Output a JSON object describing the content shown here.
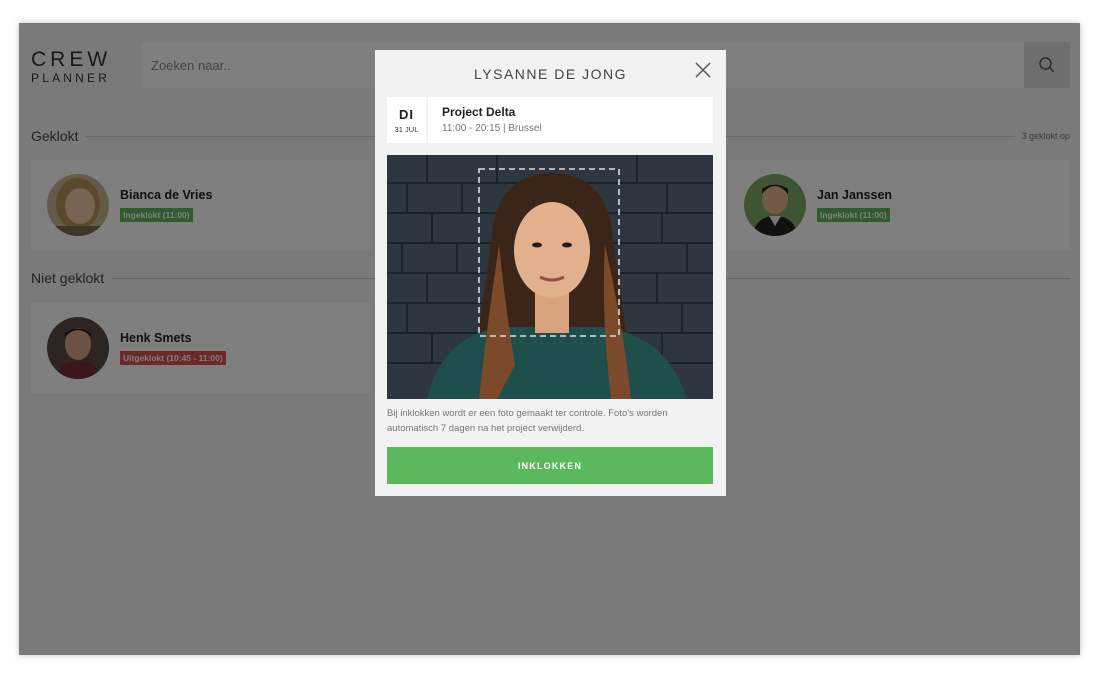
{
  "app": {
    "logo": {
      "line1": "CREW",
      "line2": "PLANNER"
    }
  },
  "search": {
    "placeholder": "Zoeken naar..",
    "icon": "search-icon"
  },
  "sections": {
    "clocked": {
      "title": "Geklokt",
      "count": "3 geklokt op",
      "cards": [
        {
          "name": "Bianca de Vries",
          "status": "Ingeklokt (11:00)",
          "status_color": "#5cb85c"
        },
        {
          "name": "Jan Janssen",
          "status": "Ingeklokt (11:00)",
          "status_color": "#5cb85c"
        }
      ]
    },
    "not_clocked": {
      "title": "Niet geklokt",
      "cards": [
        {
          "name": "Henk Smets",
          "status": "Uitgeklokt (10:45 - 11:00)",
          "status_color": "#d9534f"
        }
      ]
    }
  },
  "modal": {
    "title": "LYSANNE DE JONG",
    "close_icon": "close-icon",
    "event": {
      "day": "DI",
      "date": "31 JUL",
      "title": "Project Delta",
      "subtitle": "11:00 - 20:15 | Brussel"
    },
    "note": "Bij inklokken wordt er een foto gemaakt ter controle. Foto's worden automatisch 7 dagen na het project verwijderd.",
    "button_label": "INKLOKKEN",
    "accent": "#5cb85c"
  }
}
